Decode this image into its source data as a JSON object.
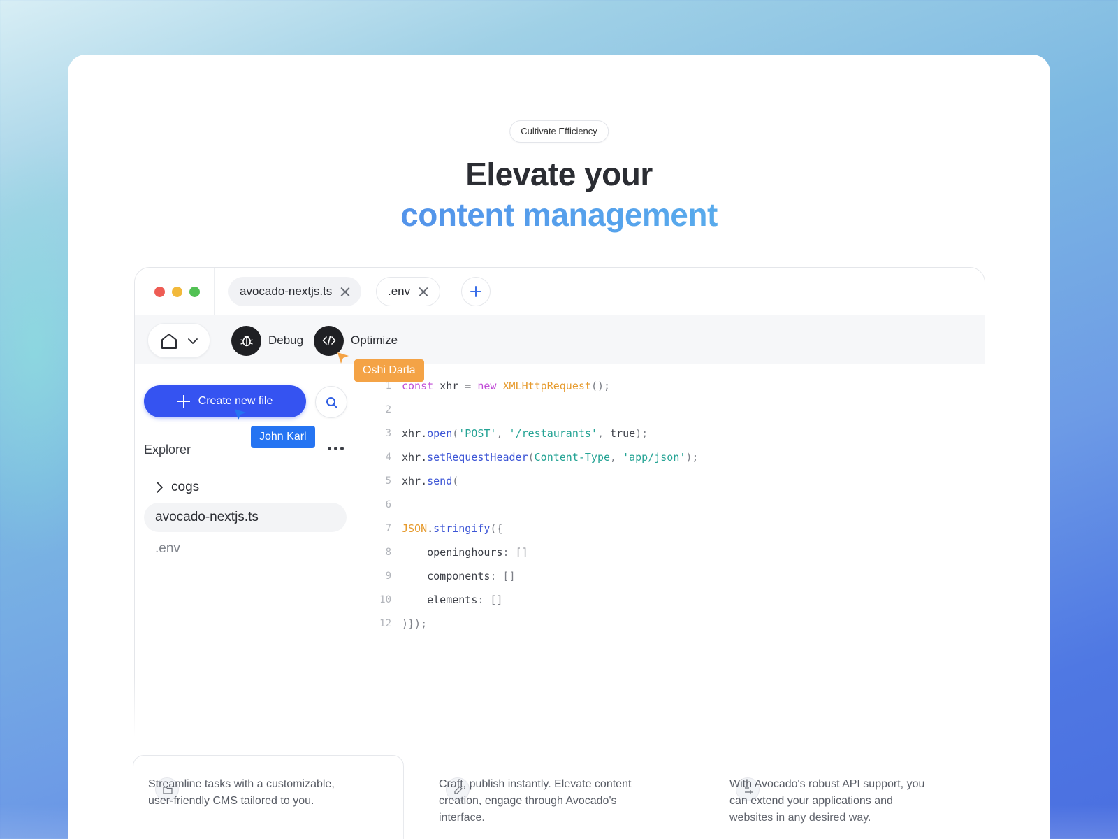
{
  "hero": {
    "badge": "Cultivate Efficiency",
    "title_line1": "Elevate your",
    "title_line2": "content management"
  },
  "window": {
    "tabs": [
      {
        "label": "avocado-nextjs.ts",
        "active": true
      },
      {
        "label": ".env",
        "active": false
      }
    ],
    "toolbar": {
      "debug_label": "Debug",
      "optimize_label": "Optimize"
    },
    "sidebar": {
      "create_label": "Create new file",
      "explorer_title": "Explorer",
      "tree": [
        {
          "label": "cogs",
          "type": "folder"
        },
        {
          "label": "avocado-nextjs.ts",
          "type": "file",
          "active": true
        },
        {
          "label": ".env",
          "type": "file",
          "active": false
        }
      ]
    },
    "code": {
      "line_numbers": [
        "1",
        "2",
        "3",
        "4",
        "5",
        "6",
        "7",
        "8",
        "9",
        "10",
        "12"
      ]
    }
  },
  "cursors": [
    {
      "name": "Oshi Darla",
      "color": "#f4a346"
    },
    {
      "name": "John Karl",
      "color": "#2574f2"
    }
  ],
  "features": [
    {
      "text": "Streamline tasks with a customizable, user-friendly CMS tailored to you."
    },
    {
      "text": "Craft, publish instantly. Elevate content creation, engage through Avocado's interface."
    },
    {
      "text": "With Avocado's robust API support, you can extend your applications and websites in any desired way."
    }
  ],
  "colors": {
    "accent": "#3553f1",
    "title_gradient_start": "#4f7ce8",
    "title_gradient_end": "#5cc6ee"
  }
}
